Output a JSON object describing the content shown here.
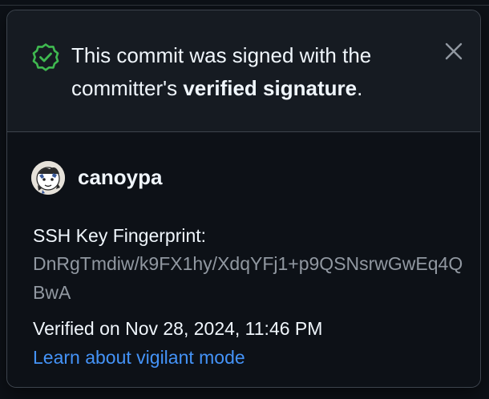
{
  "popover": {
    "message_prefix": "This commit was signed with the committer's",
    "message_bold": "verified signature",
    "message_suffix": ".",
    "close_icon": "x-icon",
    "status_icon": "verified-badge-icon"
  },
  "signer": {
    "username": "canoypa",
    "avatar_icon": "avatar"
  },
  "key": {
    "label": "SSH Key Fingerprint:",
    "fingerprint": "DnRgTmdiw/k9FX1hy/XdqYFj1+p9QSNsrwGwEq4QBwA"
  },
  "verified_on": "Verified on Nov 28, 2024, 11:46 PM",
  "learn_link": "Learn about vigilant mode",
  "colors": {
    "verified_green": "#3fb950",
    "link_blue": "#4493f8",
    "text_primary": "#f0f6fc",
    "text_muted": "#9198a1",
    "header_bg": "#161b22",
    "body_bg": "#0d1117"
  }
}
